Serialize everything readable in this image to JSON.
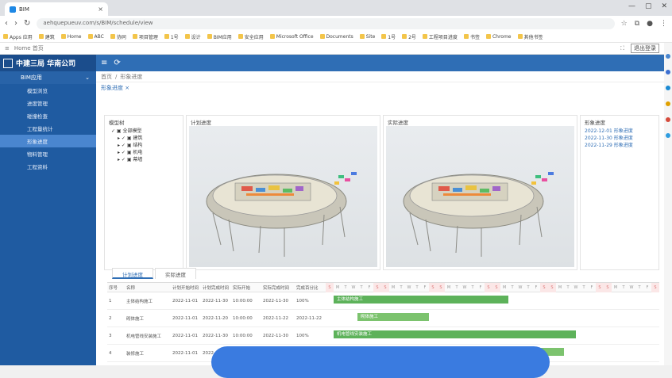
{
  "browser": {
    "tab_title": "BIM",
    "url": "aehquepueuv.com/s/BIM/schedule/view",
    "window_controls": [
      "—",
      "▢",
      "✕"
    ]
  },
  "bookmarks": [
    "Apps 应用",
    "建筑",
    "Home",
    "ABC",
    "协同",
    "项目管理",
    "1号",
    "设计",
    "BIM应用",
    "安全应用",
    "Microsoft Office",
    "Documents",
    "Site",
    "1号",
    "2号",
    "工程项目进度",
    "书签",
    "Chrome",
    "其他书签"
  ],
  "secondary_bar": {
    "left": "Home 首页",
    "right_button": "退出登录"
  },
  "app": {
    "title": "中建三局 华南公司",
    "accent": "#2f6eb5"
  },
  "sidebar": {
    "group": "BIM应用",
    "items": [
      "模型浏览",
      "进度管理",
      "碰撞检查",
      "工程量统计",
      "形象进度",
      "物料管理",
      "工程资料"
    ],
    "active_index": 4
  },
  "breadcrumb": [
    "首页",
    "形象进度"
  ],
  "page_tab": "形象进度 ×",
  "panels": {
    "tree": {
      "title": "模型树",
      "root": "✓ ▣ 全部模型",
      "children": [
        "▸ ✓ ▣ 建筑",
        "▸ ✓ ▣ 结构",
        "▸ ✓ ▣ 机电",
        "▸ ✓ ▣ 幕墙"
      ]
    },
    "planned": {
      "title": "计划进度"
    },
    "actual": {
      "title": "实际进度"
    },
    "history": {
      "title": "形象进度",
      "items": [
        "2022-12-01 形象进度",
        "2022-11-30 形象进度",
        "2022-11-29 形象进度"
      ]
    }
  },
  "gantt_tabs": [
    "计划进度",
    "实际进度"
  ],
  "gantt": {
    "headers": [
      "序号",
      "名称",
      "计划开始时间",
      "计划完成时间",
      "实际开始",
      "实际完成时间",
      "完成百分比"
    ],
    "days": [
      "S",
      "M",
      "T",
      "W",
      "T",
      "F",
      "S",
      "S",
      "M",
      "T",
      "W",
      "T",
      "F",
      "S",
      "S",
      "M",
      "T",
      "W",
      "T",
      "F",
      "S",
      "S",
      "M",
      "T",
      "W",
      "T",
      "F",
      "S",
      "S",
      "M",
      "T",
      "W",
      "T",
      "F",
      "S",
      "S",
      "M",
      "T",
      "W",
      "T",
      "F",
      "S"
    ],
    "rows": [
      {
        "no": "1",
        "name": "主体结构施工",
        "ps": "2022-11-01",
        "pe": "2022-11-30",
        "as": "10:00:00",
        "ae": "2022-11-30",
        "pct": "100%",
        "bar": "主体结构施工"
      },
      {
        "no": "2",
        "name": "砌体施工",
        "ps": "2022-11-01",
        "pe": "2022-11-20",
        "as": "10:00:00",
        "ae": "2022-11-22",
        "pct": "2022-11-22",
        "bar": "砌体施工"
      },
      {
        "no": "3",
        "name": "机电管线安装施工",
        "ps": "2022-11-01",
        "pe": "2022-11-30",
        "as": "10:00:00",
        "ae": "2022-11-30",
        "pct": "100%",
        "bar": "机电管线安装施工"
      },
      {
        "no": "4",
        "name": "装修施工",
        "ps": "2022-11-01",
        "pe": "2022-11-30",
        "as": "10:00:00",
        "ae": "2022-11-30",
        "pct": "2022-11-30",
        "bar": "装修施工"
      }
    ]
  }
}
